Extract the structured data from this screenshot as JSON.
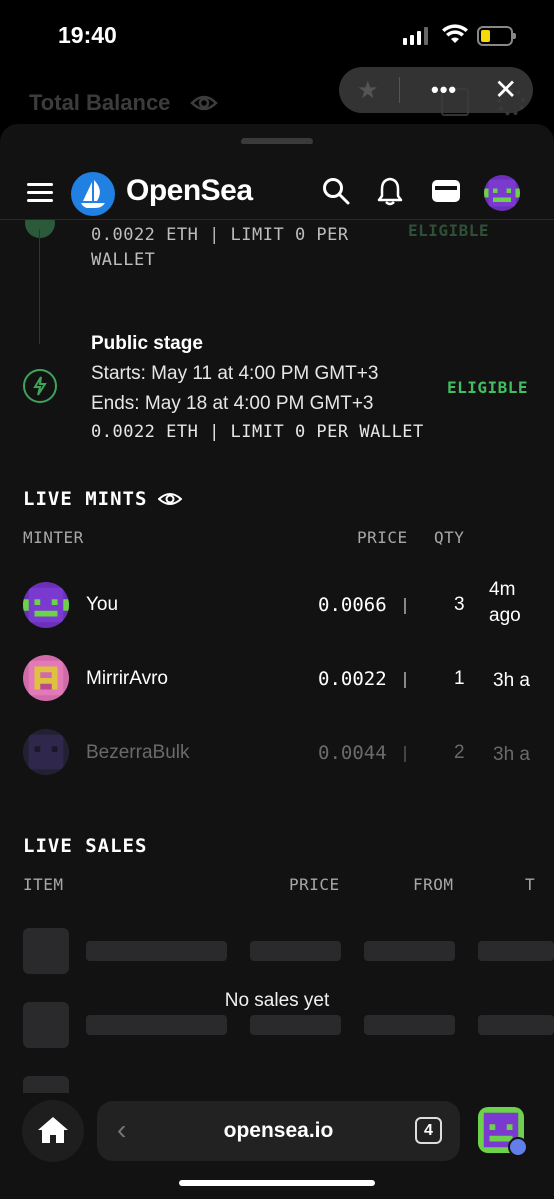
{
  "status": {
    "time": "19:40"
  },
  "behind": {
    "title": "Total Balance"
  },
  "browser_pill": {
    "more_label": "•••",
    "close_label": "✕"
  },
  "nav": {
    "brand": "OpenSea"
  },
  "stages": {
    "prev_price": "0.0022 ETH | LIMIT 0 PER",
    "prev_price_line2": "WALLET",
    "prev_status": "ELIGIBLE",
    "public": {
      "title": "Public stage",
      "starts": "Starts: May 11 at 4:00 PM GMT+3",
      "ends": "Ends: May 18 at 4:00 PM GMT+3",
      "price": "0.0022 ETH | LIMIT 0 PER WALLET",
      "status": "ELIGIBLE"
    }
  },
  "live_mints": {
    "title": "LIVE MINTS",
    "headers": {
      "minter": "MINTER",
      "price": "PRICE",
      "qty": "QTY"
    },
    "rows": [
      {
        "name": "You",
        "price": "0.0066",
        "qty": "3",
        "when1": "4m",
        "when2": "ago"
      },
      {
        "name": "MirrirAvro",
        "price": "0.0022",
        "qty": "1",
        "when1": "3h a",
        "when2": ""
      },
      {
        "name": "BezerraBulk",
        "price": "0.0044",
        "qty": "2",
        "when1": "3h a",
        "when2": ""
      }
    ]
  },
  "live_sales": {
    "title": "LIVE SALES",
    "headers": {
      "item": "ITEM",
      "price": "PRICE",
      "from": "FROM",
      "to": "T"
    },
    "empty": "No sales yet"
  },
  "bottom": {
    "url": "opensea.io",
    "tabs": "4",
    "back": "‹"
  },
  "colors": {
    "accent": "#2081e2",
    "eligible": "#3fbf5f"
  }
}
